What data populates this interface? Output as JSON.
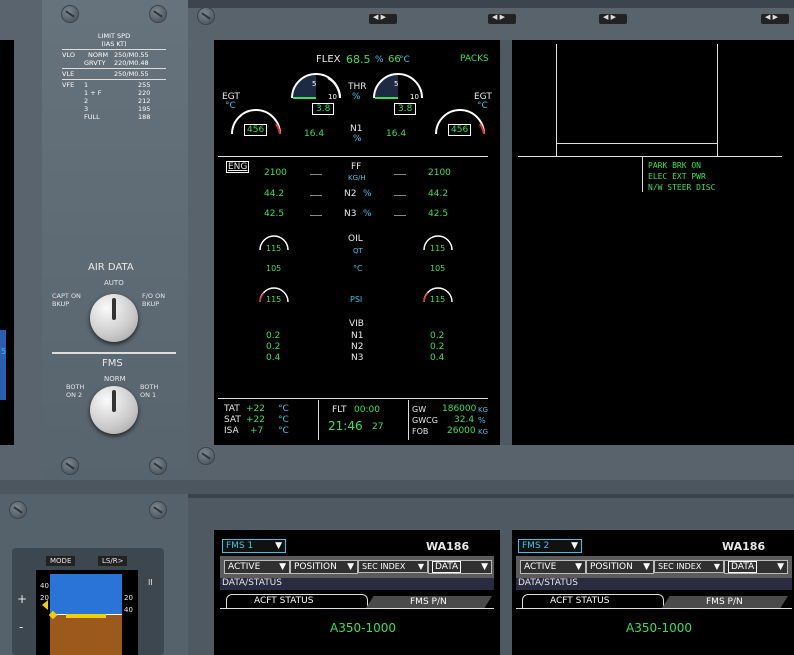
{
  "limit_spd": {
    "title1": "LIMIT SPD",
    "title2": "(IAS KT)",
    "vlo_label": "VLO",
    "norm": "NORM",
    "norm_val": "250/M0.55",
    "grvty": "GRVTY",
    "grvty_val": "220/M0.48",
    "vle_label": "VLE",
    "vle_val": "250/M0.55",
    "vfe_label": "VFE",
    "flaps": [
      {
        "pos": "1",
        "val": "255"
      },
      {
        "pos": "1 + F",
        "val": "220"
      },
      {
        "pos": "2",
        "val": "212"
      },
      {
        "pos": "3",
        "val": "195"
      },
      {
        "pos": "FULL",
        "val": "188"
      }
    ]
  },
  "air_data": {
    "title": "AIR DATA",
    "left": "CAPT ON\nBKUP",
    "top": "AUTO",
    "right": "F/O ON\nBKUP"
  },
  "fms_sel": {
    "title": "FMS",
    "left": "BOTH\nON 2",
    "top": "NORM",
    "right": "BOTH\nON 1"
  },
  "ewd": {
    "flex_label": "FLEX",
    "flex_pct": "68.5",
    "pct": "%",
    "flex_temp": "66",
    "deg_c": "°C",
    "packs": "PACKS",
    "egt": "EGT",
    "degc": "°C",
    "egt1": "456",
    "egt2": "456",
    "thr_label": "THR",
    "thr_unit": "%",
    "thr1": "3.8",
    "thr2": "3.8",
    "n1_label": "N1",
    "n1_unit": "%",
    "n1_1": "16.4",
    "n1_2": "16.4",
    "scale_5": "5",
    "scale_10": "10"
  },
  "sd": {
    "eng": "ENG",
    "ff_label": "FF",
    "ff_unit": "KG/H",
    "ff1": "2100",
    "ff2": "2100",
    "n2_label": "N2",
    "n2_unit": "%",
    "n2_1": "44.2",
    "n2_2": "44.2",
    "n3_label": "N3",
    "n3_unit": "%",
    "n3_1": "42.5",
    "n3_2": "42.5",
    "oil_label": "OIL",
    "oil_unit": "QT",
    "oil_q1": "115",
    "oil_q2": "115",
    "oil_t1": "105",
    "oil_t2": "105",
    "oil_tunit": "°C",
    "oil_p1": "115",
    "oil_p2": "115",
    "psi": "PSI",
    "vib_label": "VIB",
    "vib_n1": "N1",
    "vib_n2": "N2",
    "vib_n3": "N3",
    "vib1": [
      "0.2",
      "0.2",
      "0.4"
    ],
    "vib2": [
      "0.2",
      "0.2",
      "0.4"
    ],
    "tat": "TAT",
    "tat_v": "+22",
    "sat": "SAT",
    "sat_v": "+22",
    "isa": "ISA",
    "isa_v": "+7",
    "degc": "°C",
    "flt": "FLT",
    "flt_time": "00:00",
    "utc": "21:46",
    "utc_s": "27",
    "gw": "GW",
    "gw_v": "186000",
    "gwcg": "GWCG",
    "gwcg_v": "32.4",
    "fob": "FOB",
    "fob_v": "26000",
    "kg": "KG",
    "pct": "%"
  },
  "memo": {
    "lines": [
      "PARK BRK ON",
      "ELEC EXT PWR",
      "N/W STEER DISC"
    ]
  },
  "pfd": {
    "mode": "MODE",
    "ls": "LS/R>",
    "ticks": [
      "40",
      "20",
      "20",
      "40"
    ],
    "plus": "+",
    "minus": "-",
    "ii": "II"
  },
  "fms1": {
    "sel": "FMS 1",
    "flight": "WA186",
    "active": "ACTIVE",
    "position": "POSITION",
    "sec": "SEC INDEX",
    "data": "DATA",
    "status": "DATA/STATUS",
    "acft_tab": "ACFT STATUS",
    "pn_tab": "FMS P/N",
    "model": "A350-1000"
  },
  "fms2": {
    "sel": "FMS 2",
    "flight": "WA186",
    "active": "ACTIVE",
    "position": "POSITION",
    "sec": "SEC INDEX",
    "data": "DATA",
    "status": "DATA/STATUS",
    "acft_tab": "ACFT STATUS",
    "pn_tab": "FMS P/N",
    "model": "A350-1000"
  },
  "colors": {
    "green": "#38e05a",
    "cyan": "#39c5e8",
    "amber": "#f0a030",
    "panel": "#5a6670"
  }
}
